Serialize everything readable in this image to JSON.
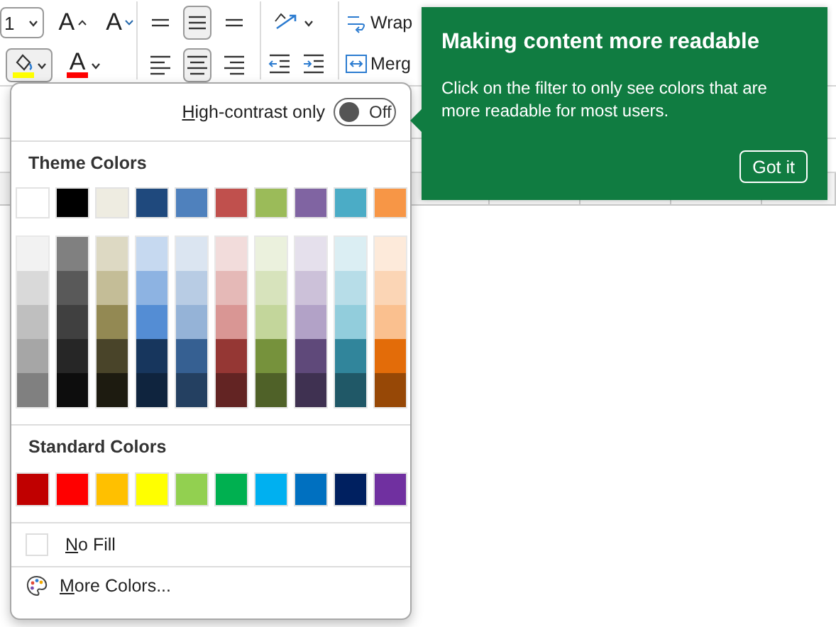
{
  "ribbon": {
    "font_size": "1",
    "grow_font": "A",
    "shrink_font": "A",
    "fill_color": {
      "color": "#ffff00"
    },
    "font_color": {
      "glyph": "A",
      "color": "#ff0000"
    },
    "vertical_alignment": [
      {
        "kind": "top",
        "selected": false
      },
      {
        "kind": "middle",
        "selected": true
      },
      {
        "kind": "bottom",
        "selected": false
      }
    ],
    "horizontal_alignment": [
      {
        "kind": "left",
        "selected": false
      },
      {
        "kind": "center",
        "selected": true
      },
      {
        "kind": "right",
        "selected": false
      }
    ],
    "wrap_text": "Wrap",
    "merge": "Merg"
  },
  "color_menu": {
    "high_contrast": {
      "label": "High-contrast only",
      "on": false,
      "state_text": "Off"
    },
    "theme_colors": {
      "title": "Theme Colors",
      "columns": [
        {
          "color": "#ffffff",
          "shades": [
            {
              "color": "#f2f2f2"
            },
            {
              "color": "#d9d9d9"
            },
            {
              "color": "#bfbfbf"
            },
            {
              "color": "#a6a6a6"
            },
            {
              "color": "#808080"
            }
          ]
        },
        {
          "color": "#000000",
          "shades": [
            {
              "color": "#808080"
            },
            {
              "color": "#595959"
            },
            {
              "color": "#404040"
            },
            {
              "color": "#262626"
            },
            {
              "color": "#0d0d0d"
            }
          ]
        },
        {
          "color": "#eeece1",
          "shades": [
            {
              "color": "#ddd9c3"
            },
            {
              "color": "#c4bd97"
            },
            {
              "color": "#938953"
            },
            {
              "color": "#494429"
            },
            {
              "color": "#1d1b10"
            }
          ]
        },
        {
          "color": "#1f497d",
          "shades": [
            {
              "color": "#c6d9f0"
            },
            {
              "color": "#8db3e2"
            },
            {
              "color": "#548dd4"
            },
            {
              "color": "#17365d"
            },
            {
              "color": "#0f243e"
            }
          ]
        },
        {
          "color": "#4f81bd",
          "shades": [
            {
              "color": "#dbe5f1"
            },
            {
              "color": "#b8cce4"
            },
            {
              "color": "#95b3d7"
            },
            {
              "color": "#366092"
            },
            {
              "color": "#244061"
            }
          ]
        },
        {
          "color": "#c0504d",
          "shades": [
            {
              "color": "#f2dcdb"
            },
            {
              "color": "#e5b9b7"
            },
            {
              "color": "#d99694"
            },
            {
              "color": "#953734"
            },
            {
              "color": "#632423"
            }
          ]
        },
        {
          "color": "#9bbb59",
          "shades": [
            {
              "color": "#ebf1dd"
            },
            {
              "color": "#d7e3bc"
            },
            {
              "color": "#c3d69b"
            },
            {
              "color": "#76923c"
            },
            {
              "color": "#4f6128"
            }
          ]
        },
        {
          "color": "#8064a2",
          "shades": [
            {
              "color": "#e5e0ec"
            },
            {
              "color": "#ccc1d9"
            },
            {
              "color": "#b2a2c7"
            },
            {
              "color": "#5f497a"
            },
            {
              "color": "#3f3151"
            }
          ]
        },
        {
          "color": "#4bacc6",
          "shades": [
            {
              "color": "#dbeef3"
            },
            {
              "color": "#b7dde8"
            },
            {
              "color": "#92cddc"
            },
            {
              "color": "#31859b"
            },
            {
              "color": "#205867"
            }
          ]
        },
        {
          "color": "#f79646",
          "shades": [
            {
              "color": "#fdeada"
            },
            {
              "color": "#fbd5b5"
            },
            {
              "color": "#fac08f"
            },
            {
              "color": "#e36c09"
            },
            {
              "color": "#974806"
            }
          ]
        }
      ]
    },
    "standard_colors": {
      "title": "Standard Colors",
      "swatches": [
        {
          "color": "#c00000"
        },
        {
          "color": "#ff0000"
        },
        {
          "color": "#ffc000"
        },
        {
          "color": "#ffff00"
        },
        {
          "color": "#92d050"
        },
        {
          "color": "#00b050"
        },
        {
          "color": "#00b0f0"
        },
        {
          "color": "#0070c0"
        },
        {
          "color": "#002060"
        },
        {
          "color": "#7030a0"
        }
      ]
    },
    "no_fill": "No Fill",
    "more_colors": "More Colors..."
  },
  "teaching_tip": {
    "title": "Making content more readable",
    "body": "Click on the filter to only see colors that are more readable for most users.",
    "button": "Got it"
  }
}
